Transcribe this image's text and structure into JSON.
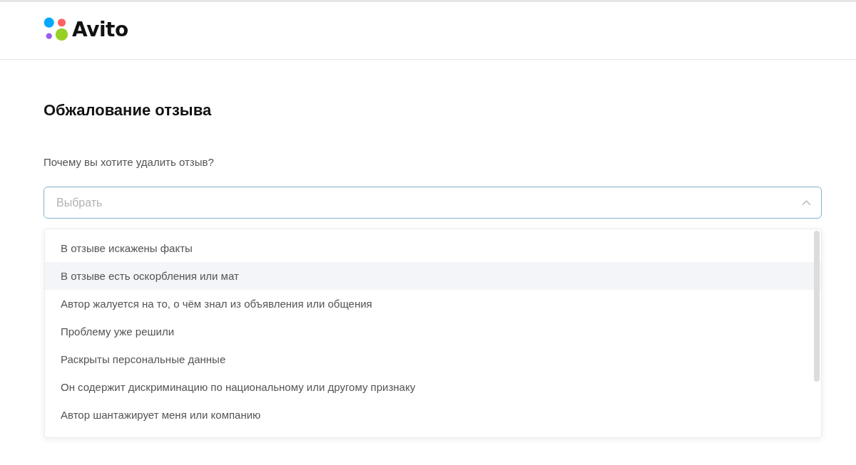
{
  "header": {
    "logo": {
      "text": "Avito"
    }
  },
  "page": {
    "title": "Обжалование отзыва",
    "question": "Почему вы хотите удалить отзыв?"
  },
  "select": {
    "placeholder": "Выбрать",
    "expanded": true,
    "options": [
      {
        "label": "В отзыве искажены факты",
        "highlighted": false
      },
      {
        "label": "В отзыве есть оскорбления или мат",
        "highlighted": true
      },
      {
        "label": "Автор жалуется на то, о чём знал из объявления или общения",
        "highlighted": false
      },
      {
        "label": "Проблему уже решили",
        "highlighted": false
      },
      {
        "label": "Раскрыты персональные данные",
        "highlighted": false
      },
      {
        "label": "Он содержит дискриминацию по национальному или другому признаку",
        "highlighted": false
      },
      {
        "label": "Автор шантажирует меня или компанию",
        "highlighted": false
      }
    ]
  }
}
